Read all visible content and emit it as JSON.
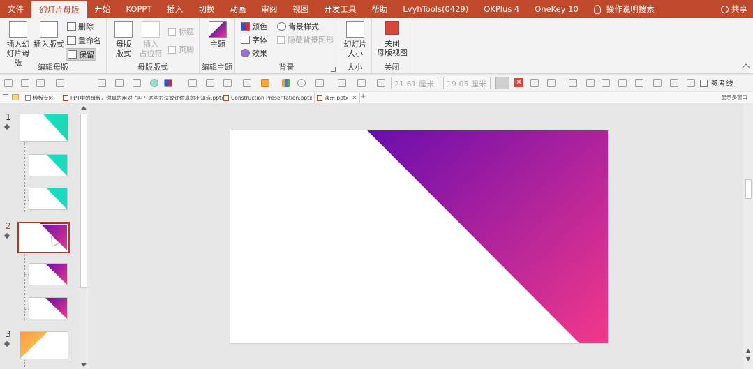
{
  "ribbon_tabs": [
    {
      "label": "文件",
      "active": false
    },
    {
      "label": "幻灯片母版",
      "active": true
    },
    {
      "label": "开始",
      "active": false
    },
    {
      "label": "KOPPT",
      "active": false
    },
    {
      "label": "插入",
      "active": false
    },
    {
      "label": "切换",
      "active": false
    },
    {
      "label": "动画",
      "active": false
    },
    {
      "label": "审阅",
      "active": false
    },
    {
      "label": "视图",
      "active": false
    },
    {
      "label": "开发工具",
      "active": false
    },
    {
      "label": "帮助",
      "active": false
    },
    {
      "label": "LvyhTools(0429)",
      "active": false
    },
    {
      "label": "OKPlus 4",
      "active": false
    },
    {
      "label": "OneKey 10",
      "active": false
    }
  ],
  "tell_me": "操作说明搜索",
  "share": "共享",
  "groups": {
    "edit_master": {
      "label": "编辑母版",
      "insert_slide_master": "插入幻\n灯片母版",
      "insert_layout": "插入版式",
      "delete": "删除",
      "rename": "重命名",
      "preserve": "保留"
    },
    "master_layout": {
      "label": "母版版式",
      "master_layout_btn": "母版\n版式",
      "insert_placeholder": "插入\n占位符",
      "title": "标题",
      "footer": "页脚"
    },
    "edit_theme": {
      "label": "编辑主题",
      "theme": "主题"
    },
    "background": {
      "label": "背景",
      "colors": "颜色",
      "fonts": "字体",
      "effects": "效果",
      "bg_styles": "背景样式",
      "hide_bg": "隐藏背景图形"
    },
    "size": {
      "label": "大小",
      "slide_size": "幻灯片\n大小"
    },
    "close": {
      "label": "关闭",
      "close_master": "关闭\n母版视图"
    }
  },
  "quickbar": {
    "width_value": "21.61 厘米",
    "height_value": "19.05 厘米",
    "guides": "参考线"
  },
  "doc_tabs": [
    {
      "label": "模板专区",
      "active": false
    },
    {
      "label": "PPT中的母版，你真的用对了吗？这些方法或许你真的不知道.pptx",
      "active": false
    },
    {
      "label": "Construction Presentation.pptx",
      "active": false
    },
    {
      "label": "演示.pptx",
      "active": true
    }
  ],
  "doc_tabs_right": "显示多窗口",
  "slide_numbers": [
    "1",
    "2",
    "3"
  ],
  "colors": {
    "ribbon": "#c0482b",
    "teal_a": "#16e0c8",
    "teal_b": "#1fd6a6",
    "purple": "#6a0dad",
    "pink": "#f2388a",
    "selection": "#b03b24"
  }
}
